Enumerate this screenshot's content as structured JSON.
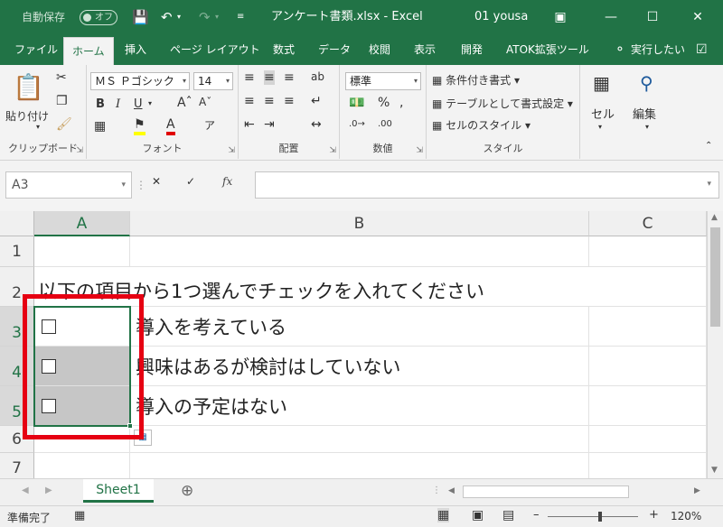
{
  "window": {
    "autosave_label": "自動保存",
    "autosave_state": "オフ",
    "doc_title": "アンケート書類.xlsx  -  Excel",
    "user": "01 yousa"
  },
  "tabs": [
    "ファイル",
    "ホーム",
    "挿入",
    "ページ レイアウト",
    "数式",
    "データ",
    "校閲",
    "表示",
    "開発",
    "ATOK拡張ツール"
  ],
  "tell_me": "実行したい",
  "ribbon": {
    "clipboard": {
      "paste": "貼り付け",
      "label": "クリップボード"
    },
    "font": {
      "name": "ＭＳ Ｐゴシック",
      "size": "14",
      "bold": "B",
      "italic": "I",
      "underline": "U",
      "label": "フォント"
    },
    "alignment": {
      "label": "配置"
    },
    "number": {
      "format": "標準",
      "label": "数値"
    },
    "styles": {
      "conditional": "条件付き書式",
      "table": "テーブルとして書式設定",
      "cell_style": "セルのスタイル",
      "label": "スタイル"
    },
    "cells": {
      "label": "セル"
    },
    "editing": {
      "label": "編集"
    }
  },
  "formula_bar": {
    "name_box": "A3",
    "fx": "fx",
    "value": ""
  },
  "columns": [
    "A",
    "B",
    "C"
  ],
  "rows": [
    "1",
    "2",
    "3",
    "4",
    "5",
    "6",
    "7"
  ],
  "cells": {
    "A2": "以下の項目から1つ選んでチェックを入れてください",
    "B3": "導入を考えている",
    "B4": "興味はあるが検討はしていない",
    "B5": "導入の予定はない"
  },
  "sheets": [
    "Sheet1"
  ],
  "status": {
    "ready": "準備完了",
    "zoom": "120%"
  },
  "colors": {
    "excel_green": "#217346",
    "highlight_red": "#e60012"
  }
}
